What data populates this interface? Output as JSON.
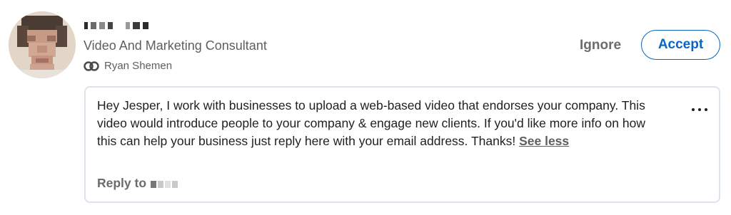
{
  "invitation": {
    "sender_name": "",
    "headline": "Video And Marketing Consultant",
    "mutual_connection": "Ryan Shemen",
    "icons": {
      "mutual": "mutual-connections-icon",
      "more": "more-options-icon"
    },
    "actions": {
      "ignore_label": "Ignore",
      "accept_label": "Accept"
    },
    "message": {
      "body": "Hey Jesper, I work with businesses to upload a web-based video that endorses your company. This video would introduce people to your company & engage new clients. If you'd like more info on how this can help your business just reply here with your email address. Thanks!",
      "see_less_label": "See less",
      "reply_label": "Reply to"
    },
    "colors": {
      "accent": "#0a66c2",
      "muted_text": "#5e5e5e",
      "border": "#dbe3ec"
    }
  }
}
